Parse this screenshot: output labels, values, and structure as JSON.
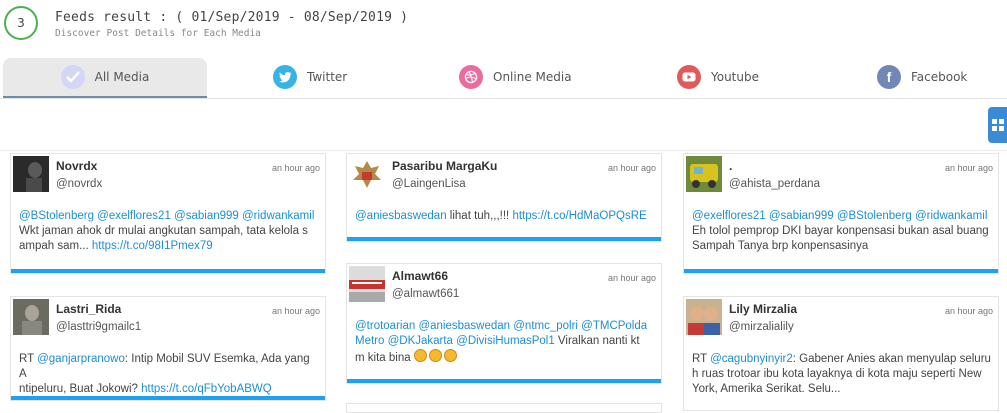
{
  "header": {
    "step_number": "3",
    "title": "Feeds result :  ( 01/Sep/2019 - 08/Sep/2019 )",
    "subtitle": "Discover Post Details for Each Media"
  },
  "tabs": [
    {
      "label": "All Media",
      "icon": "check-icon",
      "color": "#c9cdf2"
    },
    {
      "label": "Twitter",
      "icon": "twitter-icon",
      "color": "#37b3e6"
    },
    {
      "label": "Online Media",
      "icon": "dribbble-icon",
      "color": "#ea6b9f"
    },
    {
      "label": "Youtube",
      "icon": "youtube-icon",
      "color": "#e05a5a"
    },
    {
      "label": "Facebook",
      "icon": "facebook-icon",
      "color": "#7187b5"
    }
  ],
  "posts": {
    "c1p1": {
      "name": "Novrdx",
      "handle": "@novrdx",
      "time": "an hour ago",
      "l1": "@BStolenberg @exelflores21 @sabian999 @ridwankamil",
      "l2": "Wkt jaman ahok dr mulai angkutan sampah, tata kelola s",
      "l3a": "ampah sam... ",
      "l3b": "https://t.co/98I1Pmex79"
    },
    "c1p2": {
      "name": "Lastri_Rida",
      "handle": "@lasttri9gmailc1",
      "time": "an hour ago",
      "l1a": "RT ",
      "l1b": "@ganjarpranowo",
      "l1c": ": Intip Mobil SUV Esemka, Ada yang A",
      "l2a": "ntipeluru, Buat Jokowi? ",
      "l2b": "https://t.co/qFbYobABWQ"
    },
    "c2p1": {
      "name": "Pasaribu MargaKu",
      "handle": "@LaingenLisa",
      "time": "an hour ago",
      "l1a": "@aniesbaswedan",
      "l1b": " lihat tuh,,,!!! ",
      "l1c": "https://t.co/HdMaOPQsRE"
    },
    "c2p2": {
      "name": "Almawt66",
      "handle": "@almawt661",
      "time": "an hour ago",
      "l1": "@trotoarian @aniesbaswedan @ntmc_polri @TMCPolda",
      "l2a": "Metro @DKJakarta @DivisiHumasPol1",
      "l2b": " Viralkan nanti kt",
      "l3": "m kita bina "
    },
    "c3p1": {
      "name": ".",
      "handle": "@ahista_perdana",
      "time": "an hour ago",
      "l1": "@exelflores21 @sabian999 @BStolenberg @ridwankamil",
      "l2": "Eh tolol pemprop DKI bayar konpensasi bukan asal buang",
      "l3": "Sampah Tanya brp konpensasinya"
    },
    "c3p2": {
      "name": "Lily Mirzalia",
      "handle": "@mirzalialily",
      "time": "an hour ago",
      "l1a": "RT ",
      "l1b": "@cagubnyinyir2",
      "l1c": ": Gabener Anies akan menyulap seluru",
      "l2": "h ruas trotoar ibu kota layaknya di kota maju seperti New",
      "l3": "York, Amerika Serikat.  Selu..."
    }
  },
  "colors": {
    "accent": "#1da1f2",
    "link": "#1a8fd8",
    "step_ring": "#4caf50"
  }
}
